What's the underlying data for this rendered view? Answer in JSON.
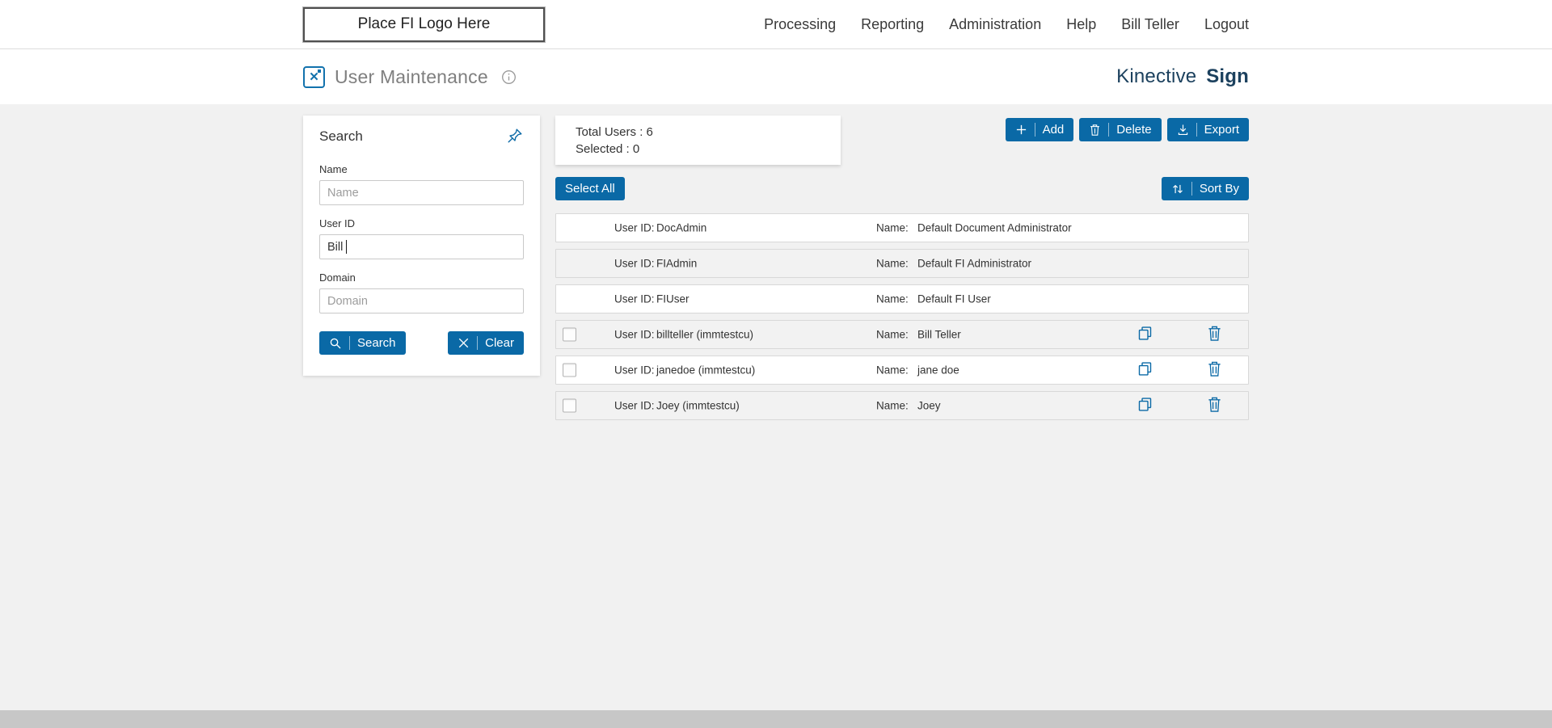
{
  "colors": {
    "accent": "#0a69a6",
    "brand_text": "#1c415e",
    "page_bg": "#f1f1f1"
  },
  "top_nav": {
    "logo_placeholder": "Place FI Logo Here",
    "items": [
      "Processing",
      "Reporting",
      "Administration",
      "Help",
      "Bill Teller",
      "Logout"
    ]
  },
  "header": {
    "title": "User Maintenance",
    "brand_name": "Kinective",
    "brand_product": "Sign"
  },
  "search_panel": {
    "title": "Search",
    "name_label": "Name",
    "name_placeholder": "Name",
    "name_value": "",
    "user_id_label": "User ID",
    "user_id_value": "Bill",
    "domain_label": "Domain",
    "domain_placeholder": "Domain",
    "domain_value": "",
    "search_button": "Search",
    "clear_button": "Clear"
  },
  "summary": {
    "total_users": "Total Users : 6",
    "selected": "Selected : 0"
  },
  "toolbar": {
    "add": "Add",
    "delete": "Delete",
    "export": "Export",
    "select_all": "Select All",
    "sort_by": "Sort By"
  },
  "users_list": {
    "labels": {
      "user_id": "User ID:",
      "name": "Name:"
    },
    "rows": [
      {
        "user_id": "DocAdmin",
        "name": "Default Document Administrator"
      },
      {
        "user_id": "FIAdmin",
        "name": "Default FI Administrator"
      },
      {
        "user_id": "FIUser",
        "name": "Default FI User"
      },
      {
        "user_id": "billteller (immtestcu)",
        "name": "Bill Teller"
      },
      {
        "user_id": "janedoe (immtestcu)",
        "name": "jane doe"
      },
      {
        "user_id": "Joey (immtestcu)",
        "name": "Joey"
      }
    ]
  }
}
